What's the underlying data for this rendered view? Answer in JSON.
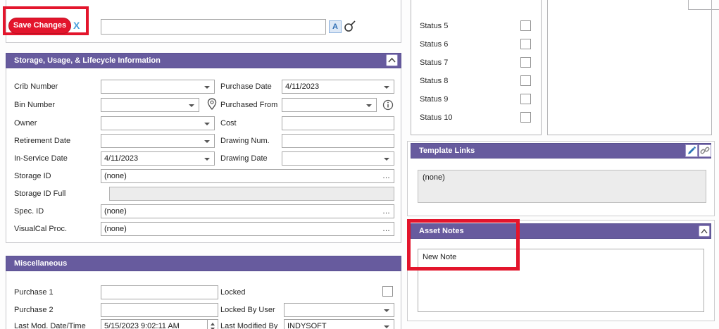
{
  "toolbar": {
    "save_label": "Save Changes",
    "discard_label": "X"
  },
  "search": {
    "value": "",
    "font_button": "A"
  },
  "storage": {
    "title": "Storage, Usage, & Lifecycle Information",
    "crib_number_label": "Crib Number",
    "crib_number_value": "",
    "purchase_date_label": "Purchase Date",
    "purchase_date_value": "4/11/2023",
    "bin_number_label": "Bin Number",
    "bin_number_value": "",
    "purchased_from_label": "Purchased From",
    "purchased_from_value": "",
    "owner_label": "Owner",
    "owner_value": "",
    "cost_label": "Cost",
    "cost_value": "",
    "retirement_date_label": "Retirement Date",
    "retirement_date_value": "",
    "drawing_num_label": "Drawing Num.",
    "drawing_num_value": "",
    "in_service_date_label": "In-Service Date",
    "in_service_date_value": "4/11/2023",
    "drawing_date_label": "Drawing Date",
    "drawing_date_value": "",
    "storage_id_label": "Storage ID",
    "storage_id_value": "(none)",
    "storage_id_full_label": "Storage ID Full",
    "storage_id_full_value": "",
    "spec_id_label": "Spec. ID",
    "spec_id_value": "(none)",
    "visualcal_proc_label": "VisualCal Proc.",
    "visualcal_proc_value": "(none)"
  },
  "misc": {
    "title": "Miscellaneous",
    "purchase1_label": "Purchase 1",
    "purchase1_value": "",
    "purchase2_label": "Purchase 2",
    "purchase2_value": "",
    "last_mod_label": "Last Mod. Date/Time",
    "last_mod_value": "5/15/2023 9:02:11 AM",
    "locked_label": "Locked",
    "locked_by_label": "Locked By User",
    "locked_by_value": "",
    "last_modified_by_label": "Last Modified By",
    "last_modified_by_value": "INDYSOFT"
  },
  "status_panel": {
    "items": [
      {
        "label": "Status 5",
        "checked": false
      },
      {
        "label": "Status 6",
        "checked": false
      },
      {
        "label": "Status 7",
        "checked": false
      },
      {
        "label": "Status 8",
        "checked": false
      },
      {
        "label": "Status 9",
        "checked": false
      },
      {
        "label": "Status 10",
        "checked": false
      }
    ]
  },
  "template_links": {
    "title": "Template Links",
    "content": "(none)"
  },
  "asset_notes": {
    "title": "Asset Notes",
    "note": "New Note"
  },
  "ui": {
    "ellipsis": "…"
  },
  "colors": {
    "header_purple": "#675b9e",
    "highlight_red": "#e3152c",
    "discard_blue": "#4aa0dc"
  }
}
